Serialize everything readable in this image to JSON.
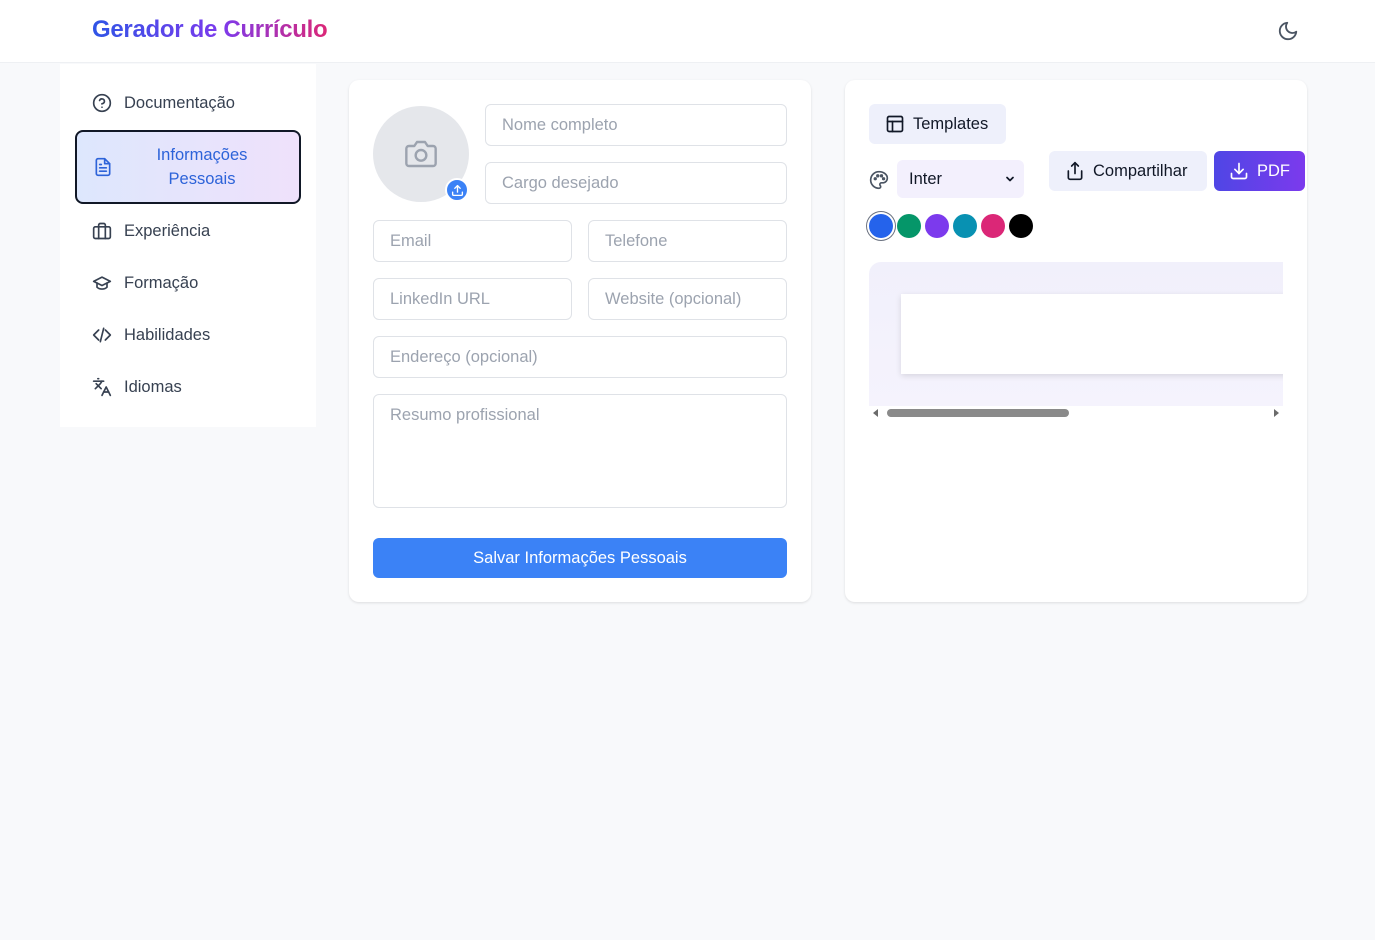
{
  "header": {
    "title": "Gerador de Currículo",
    "theme_toggle_icon": "moon-icon"
  },
  "sidebar": {
    "items": [
      {
        "label": "Documentação",
        "icon": "help-circle-icon",
        "active": false
      },
      {
        "label": "Informações Pessoais",
        "icon": "document-icon",
        "active": true
      },
      {
        "label": "Experiência",
        "icon": "briefcase-icon",
        "active": false
      },
      {
        "label": "Formação",
        "icon": "graduation-cap-icon",
        "active": false
      },
      {
        "label": "Habilidades",
        "icon": "code-icon",
        "active": false
      },
      {
        "label": "Idiomas",
        "icon": "translate-icon",
        "active": false
      }
    ]
  },
  "form": {
    "avatar_icon": "camera-icon",
    "upload_icon": "upload-icon",
    "fields": {
      "full_name": {
        "placeholder": "Nome completo",
        "value": ""
      },
      "job_title": {
        "placeholder": "Cargo desejado",
        "value": ""
      },
      "email": {
        "placeholder": "Email",
        "value": ""
      },
      "phone": {
        "placeholder": "Telefone",
        "value": ""
      },
      "linkedin": {
        "placeholder": "LinkedIn URL",
        "value": ""
      },
      "website": {
        "placeholder": "Website (opcional)",
        "value": ""
      },
      "address": {
        "placeholder": "Endereço (opcional)",
        "value": ""
      },
      "summary": {
        "placeholder": "Resumo profissional",
        "value": ""
      }
    },
    "save_label": "Salvar Informações Pessoais"
  },
  "preview": {
    "templates_label": "Templates",
    "font_select": {
      "selected": "Inter"
    },
    "share_label": "Compartilhar",
    "pdf_label": "PDF",
    "colors": [
      "#2563eb",
      "#059669",
      "#7c3aed",
      "#0891b2",
      "#db2777",
      "#000000"
    ],
    "selected_color_index": 0
  },
  "colors": {
    "primary": "#3b82f6",
    "page_bg": "#f8f9fb",
    "active_nav_text": "#2d63d9"
  }
}
